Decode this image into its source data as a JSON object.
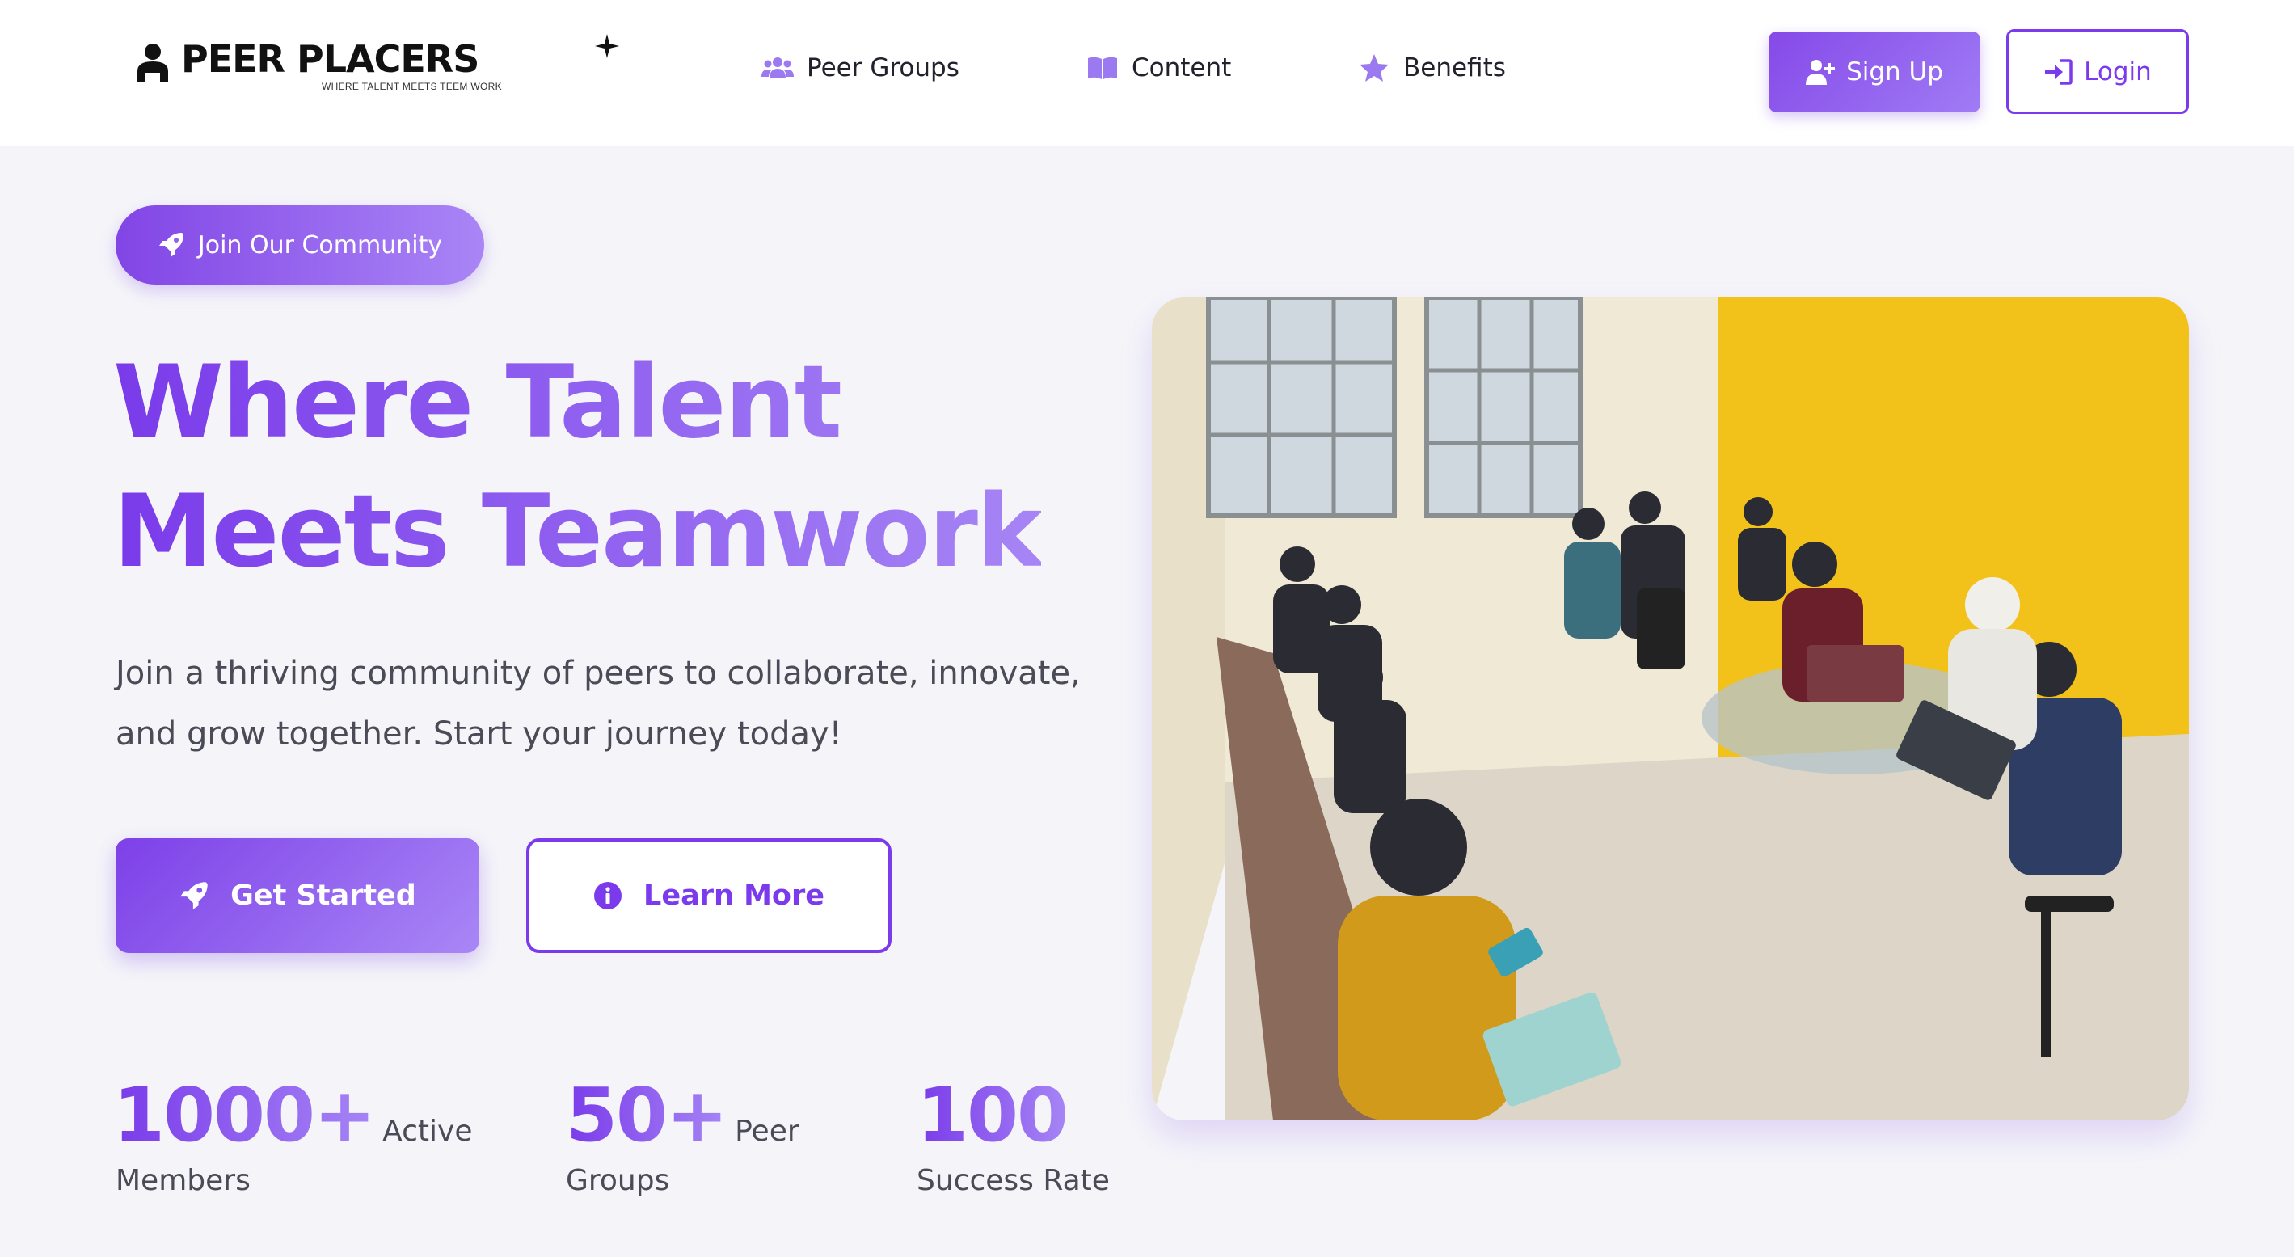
{
  "brand": {
    "name": "PEER PLACERS",
    "tagline": "WHERE TALENT MEETS TEEM WORK"
  },
  "nav": {
    "links": [
      {
        "label": "Peer Groups",
        "icon": "users-icon"
      },
      {
        "label": "Content",
        "icon": "book-icon"
      },
      {
        "label": "Benefits",
        "icon": "star-icon"
      }
    ],
    "signup_label": "Sign Up",
    "login_label": "Login"
  },
  "hero": {
    "badge": "Join Our Community",
    "headline_line1": "Where Talent",
    "headline_line2": "Meets Teamwork",
    "subtitle": "Join a thriving community of peers to collaborate, innovate, and grow together. Start your journey today!",
    "primary_cta": "Get Started",
    "secondary_cta": "Learn More"
  },
  "stats": [
    {
      "value": "1000+",
      "inline": "Active",
      "label": "Members"
    },
    {
      "value": "50+",
      "inline": "Peer",
      "label": "Groups"
    },
    {
      "value": "100",
      "inline": "",
      "label": "Success Rate"
    }
  ],
  "colors": {
    "accent": "#7c3aed",
    "accent_light": "#a685f5",
    "background": "#f5f5f9",
    "photo_wall": "#f2c21a"
  }
}
